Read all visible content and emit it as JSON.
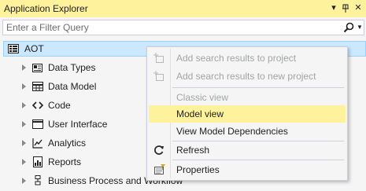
{
  "window": {
    "title": "Application Explorer",
    "dropdown_glyph": "▾",
    "pin_glyph": "ᵖ",
    "close_glyph": "✕"
  },
  "filter": {
    "placeholder": "Enter a Filter Query",
    "value": ""
  },
  "tree": {
    "root": {
      "label": "AOT",
      "icon": "aot-icon"
    },
    "nodes": [
      {
        "label": "Data Types",
        "icon": "data-types-icon"
      },
      {
        "label": "Data Model",
        "icon": "data-model-icon"
      },
      {
        "label": "Code",
        "icon": "code-icon"
      },
      {
        "label": "User Interface",
        "icon": "user-interface-icon"
      },
      {
        "label": "Analytics",
        "icon": "analytics-icon"
      },
      {
        "label": "Reports",
        "icon": "reports-icon"
      },
      {
        "label": "Business Process and Workflow",
        "icon": "business-process-icon"
      }
    ]
  },
  "context_menu": {
    "items": [
      {
        "label": "Add search results to project",
        "enabled": false,
        "icon": "add-to-project-icon"
      },
      {
        "label": "Add search results to new project",
        "enabled": false,
        "icon": "add-to-new-project-icon"
      },
      {
        "label": "Classic view",
        "enabled": false
      },
      {
        "label": "Model view",
        "enabled": true,
        "highlighted": true
      },
      {
        "label": "View Model Dependencies",
        "enabled": true
      },
      {
        "label": "Refresh",
        "enabled": true,
        "icon": "refresh-icon"
      },
      {
        "label": "Properties",
        "enabled": true,
        "icon": "properties-icon"
      }
    ]
  },
  "colors": {
    "title_bar": "#fff29d",
    "selection": "#cce8ff",
    "menu_highlight": "#fff29d",
    "disabled_text": "#a2a4a5"
  }
}
